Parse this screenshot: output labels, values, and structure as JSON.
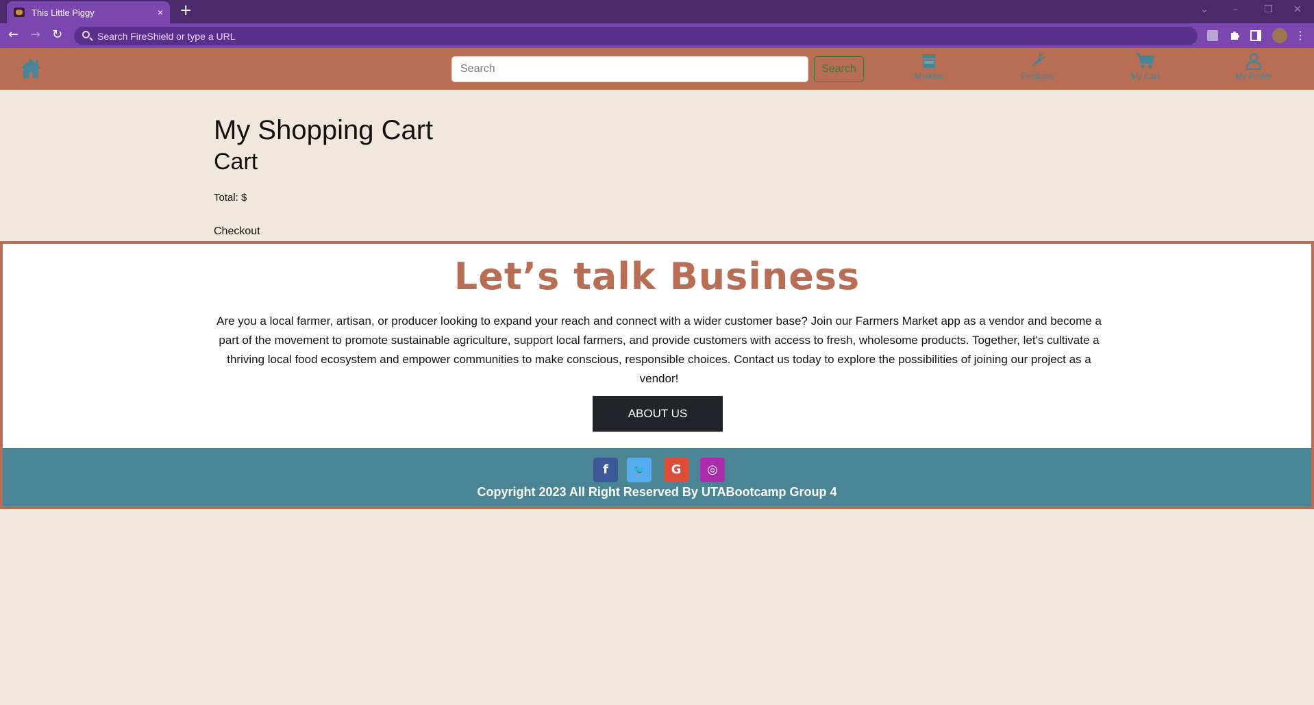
{
  "browser": {
    "tab_title": "This Little Piggy",
    "tab_close": "×",
    "new_tab": "+",
    "omnibox_placeholder": "Search FireShield or type a URL",
    "window_controls": [
      "⌄",
      "–",
      "❐",
      "✕"
    ]
  },
  "nav": {
    "search_placeholder": "Search",
    "search_button": "Search",
    "links": [
      {
        "label": "Markets",
        "icon": "market-icon"
      },
      {
        "label": "Products",
        "icon": "carrot-icon"
      },
      {
        "label": "My Cart",
        "icon": "cart-icon"
      },
      {
        "label": "My Profile",
        "icon": "user-icon"
      }
    ]
  },
  "cart": {
    "title": "My Shopping Cart",
    "subtitle": "Cart",
    "total_label": "Total: $",
    "checkout_label": "Checkout"
  },
  "business": {
    "title": "Let’s talk Business",
    "body": "Are you a local farmer, artisan, or producer looking to expand your reach and connect with a wider customer base? Join our Farmers Market app as a vendor and become a part of the movement to promote sustainable agriculture, support local farmers, and provide customers with access to fresh, wholesome products. Together, let's cultivate a thriving local food ecosystem and empower communities to make conscious, responsible choices. Contact us today to explore the possibilities of joining our project as a vendor!",
    "about_button": "ABOUT US"
  },
  "footer": {
    "social": [
      {
        "glyph": "f",
        "icon": "facebook-icon",
        "color": "#3b5998"
      },
      {
        "glyph": "🐦",
        "icon": "twitter-icon",
        "color": "#55acee"
      },
      {
        "glyph": "G",
        "icon": "google-icon",
        "color": "#dd4b39"
      },
      {
        "glyph": "◎",
        "icon": "instagram-icon",
        "color": "#ac2bac"
      }
    ],
    "copyright": "Copyright 2023 All Right Reserved By UTABootcamp Group 4"
  },
  "colors": {
    "nav_bg": "#b86d55",
    "page_bg": "#f0e8dd",
    "footer_bg": "#4a8595",
    "accent": "#b86d55",
    "browser_purple": "#7b46b0"
  }
}
